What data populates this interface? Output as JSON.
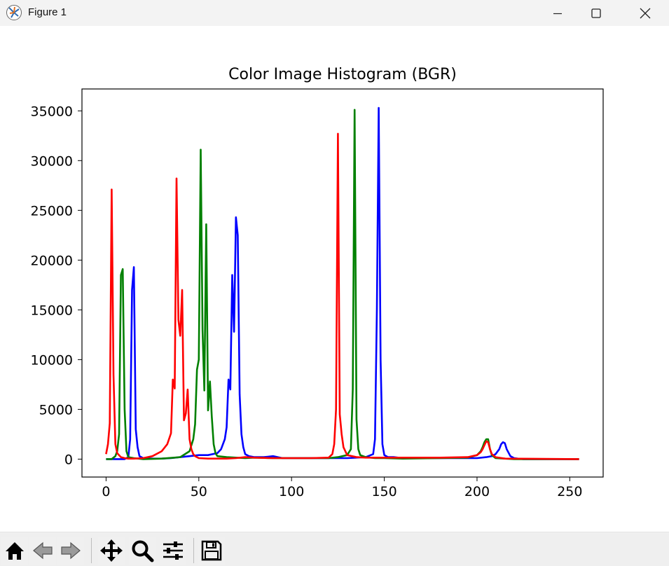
{
  "window": {
    "title": "Figure 1",
    "app_icon": "matplotlib-figure-icon",
    "controls": [
      "minimize-icon",
      "maximize-icon",
      "close-icon"
    ]
  },
  "toolbar": {
    "buttons": [
      "home-icon",
      "back-arrow-icon",
      "forward-arrow-icon",
      "pan-icon",
      "zoom-icon",
      "configure-subplots-icon",
      "save-icon"
    ]
  },
  "chart_data": {
    "type": "line",
    "title": "Color Image Histogram (BGR)",
    "xlabel": "",
    "ylabel": "",
    "xlim": [
      -13,
      268
    ],
    "ylim": [
      -1800,
      37200
    ],
    "xticks": [
      0,
      50,
      100,
      150,
      200,
      250
    ],
    "yticks": [
      0,
      5000,
      10000,
      15000,
      20000,
      25000,
      30000,
      35000
    ],
    "grid": false,
    "series": [
      {
        "color": "#0000ff",
        "x": [
          0,
          5,
          10,
          12,
          13,
          14,
          15,
          16,
          17,
          18,
          20,
          25,
          30,
          35,
          40,
          45,
          50,
          55,
          60,
          62,
          64,
          65,
          66,
          67,
          68,
          69,
          70,
          71,
          72,
          73,
          74,
          75,
          77,
          80,
          85,
          90,
          95,
          100,
          110,
          120,
          130,
          140,
          144,
          145,
          146,
          147,
          148,
          149,
          150,
          152,
          155,
          160,
          180,
          200,
          205,
          208,
          210,
          212,
          213,
          214,
          215,
          216,
          218,
          220,
          222,
          225,
          240,
          255
        ],
        "values": [
          0,
          0,
          0,
          200,
          2000,
          17000,
          19300,
          3000,
          1200,
          300,
          100,
          50,
          50,
          100,
          200,
          300,
          400,
          400,
          600,
          1000,
          2000,
          3200,
          8000,
          7000,
          18500,
          12800,
          24300,
          22500,
          6500,
          2500,
          1200,
          500,
          300,
          200,
          200,
          300,
          100,
          100,
          100,
          100,
          100,
          200,
          500,
          2000,
          15000,
          35300,
          10000,
          1500,
          400,
          200,
          200,
          100,
          100,
          100,
          200,
          300,
          500,
          1000,
          1500,
          1700,
          1600,
          1000,
          300,
          100,
          50,
          0,
          0,
          0
        ]
      },
      {
        "color": "#008000",
        "x": [
          0,
          3,
          5,
          6,
          7,
          8,
          9,
          10,
          11,
          12,
          15,
          20,
          30,
          40,
          45,
          47,
          48,
          49,
          50,
          51,
          52,
          53,
          54,
          55,
          56,
          57,
          58,
          59,
          60,
          65,
          70,
          75,
          80,
          90,
          100,
          110,
          120,
          125,
          130,
          132,
          133,
          134,
          135,
          136,
          137,
          140,
          145,
          150,
          160,
          180,
          195,
          200,
          202,
          203,
          204,
          205,
          206,
          207,
          208,
          210,
          215,
          220,
          255
        ],
        "values": [
          0,
          0,
          300,
          800,
          2500,
          18500,
          19100,
          5000,
          800,
          200,
          100,
          0,
          50,
          200,
          800,
          2000,
          3500,
          9000,
          10000,
          31100,
          13000,
          6900,
          23600,
          4900,
          7800,
          4300,
          1500,
          600,
          300,
          200,
          150,
          100,
          150,
          100,
          100,
          100,
          100,
          200,
          400,
          1000,
          7000,
          35100,
          4000,
          1000,
          400,
          200,
          100,
          100,
          50,
          100,
          150,
          400,
          800,
          1200,
          1700,
          2000,
          2000,
          1000,
          400,
          100,
          50,
          0,
          0
        ]
      },
      {
        "color": "#ff0000",
        "x": [
          0,
          1,
          2,
          3,
          4,
          5,
          6,
          8,
          10,
          12,
          15,
          20,
          25,
          30,
          33,
          35,
          36,
          37,
          38,
          39,
          40,
          41,
          42,
          43,
          44,
          45,
          46,
          47,
          48,
          50,
          55,
          60,
          65,
          70,
          75,
          80,
          90,
          100,
          110,
          120,
          122,
          123,
          124,
          125,
          126,
          127,
          128,
          130,
          135,
          140,
          150,
          160,
          180,
          195,
          200,
          202,
          203,
          204,
          205,
          206,
          207,
          208,
          210,
          215,
          255
        ],
        "values": [
          500,
          1500,
          3600,
          27100,
          8500,
          1500,
          600,
          200,
          100,
          50,
          50,
          100,
          300,
          800,
          1500,
          2600,
          8000,
          7100,
          28200,
          14000,
          12400,
          17000,
          3900,
          4600,
          7000,
          2000,
          1000,
          500,
          300,
          100,
          50,
          50,
          50,
          100,
          200,
          150,
          100,
          100,
          100,
          150,
          500,
          1500,
          5000,
          32700,
          4500,
          2500,
          1200,
          400,
          200,
          150,
          150,
          150,
          150,
          200,
          400,
          700,
          1000,
          1400,
          1800,
          1700,
          1000,
          500,
          200,
          50,
          0
        ]
      }
    ]
  }
}
